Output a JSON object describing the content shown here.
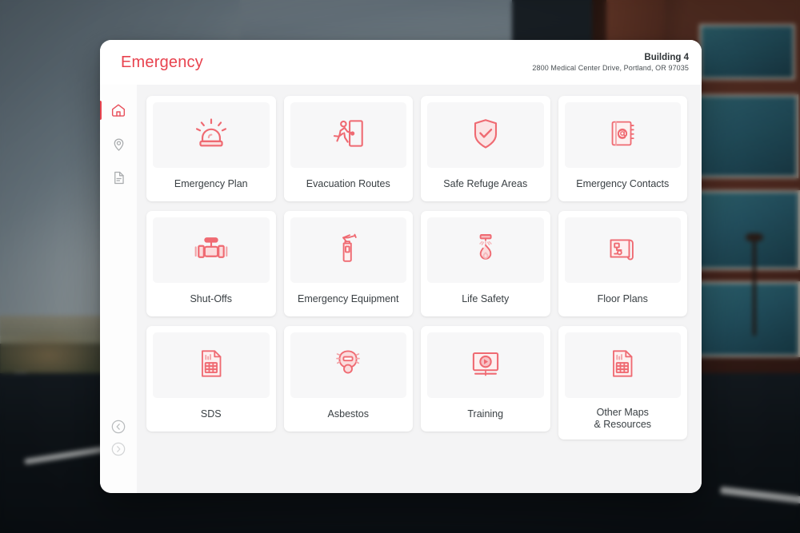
{
  "header": {
    "title": "Emergency",
    "building_name": "Building 4",
    "building_address": "2800 Medical Center Drive, Portland, OR 97035"
  },
  "sidebar": {
    "items": [
      {
        "icon": "home-icon",
        "label": "Home",
        "active": true
      },
      {
        "icon": "location-pin-icon",
        "label": "Location",
        "active": false
      },
      {
        "icon": "document-icon",
        "label": "Documents",
        "active": false
      }
    ],
    "bottom_controls": [
      {
        "icon": "chevron-left-circle-icon",
        "label": "Previous"
      },
      {
        "icon": "chevron-right-circle-icon",
        "label": "Next"
      }
    ]
  },
  "main": {
    "tiles": [
      {
        "label": "Emergency Plan",
        "icon": "siren-icon"
      },
      {
        "label": "Evacuation Routes",
        "icon": "running-exit-icon"
      },
      {
        "label": "Safe Refuge Areas",
        "icon": "shield-check-icon"
      },
      {
        "label": "Emergency Contacts",
        "icon": "address-book-icon"
      },
      {
        "label": "Shut-Offs",
        "icon": "valve-icon"
      },
      {
        "label": "Emergency Equipment",
        "icon": "fire-extinguisher-icon"
      },
      {
        "label": "Life Safety",
        "icon": "sprinkler-flame-icon"
      },
      {
        "label": "Floor Plans",
        "icon": "blueprint-icon"
      },
      {
        "label": "SDS",
        "icon": "document-table-icon"
      },
      {
        "label": "Asbestos",
        "icon": "respirator-mask-icon"
      },
      {
        "label": "Training",
        "icon": "video-play-icon"
      },
      {
        "label": "Other Maps\n& Resources",
        "icon": "document-table-icon"
      }
    ]
  },
  "colors": {
    "accent": "#e8424e",
    "icon_red": "#ef6a72",
    "icon_red_soft": "#f3a0a4",
    "panel_bg": "#ffffff",
    "content_bg": "#f4f4f5",
    "text_dark": "#3a4044"
  }
}
